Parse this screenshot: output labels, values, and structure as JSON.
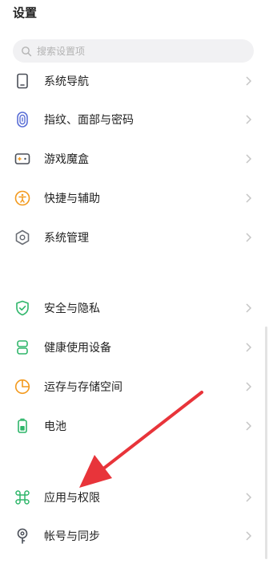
{
  "header": {
    "title": "设置"
  },
  "search": {
    "placeholder": "搜索设置项",
    "icon": "search-icon"
  },
  "groups": [
    {
      "items": [
        {
          "label": "系统导航",
          "icon": "phone-navigation-icon",
          "color": "#4a4f58"
        },
        {
          "label": "指纹、面部与密码",
          "icon": "fingerprint-icon",
          "color": "#5b6fd6"
        },
        {
          "label": "游戏魔盒",
          "icon": "game-box-icon",
          "color": "#4a4f58"
        },
        {
          "label": "快捷与辅助",
          "icon": "accessibility-icon",
          "color": "#f39a1e"
        },
        {
          "label": "系统管理",
          "icon": "hexagon-settings-icon",
          "color": "#6b6f76"
        }
      ]
    },
    {
      "items": [
        {
          "label": "安全与隐私",
          "icon": "shield-check-icon",
          "color": "#2fb66a"
        },
        {
          "label": "健康使用设备",
          "icon": "hourglass-icon",
          "color": "#2fb66a"
        },
        {
          "label": "运存与存储空间",
          "icon": "storage-pie-icon",
          "color": "#f39a1e"
        },
        {
          "label": "电池",
          "icon": "battery-icon",
          "color": "#2fb66a"
        }
      ]
    },
    {
      "items": [
        {
          "label": "应用与权限",
          "icon": "command-apps-icon",
          "color": "#2fb66a"
        },
        {
          "label": "帐号与同步",
          "icon": "account-key-icon",
          "color": "#4a4f58"
        }
      ]
    }
  ],
  "annotation": {
    "color": "#e8343a"
  }
}
